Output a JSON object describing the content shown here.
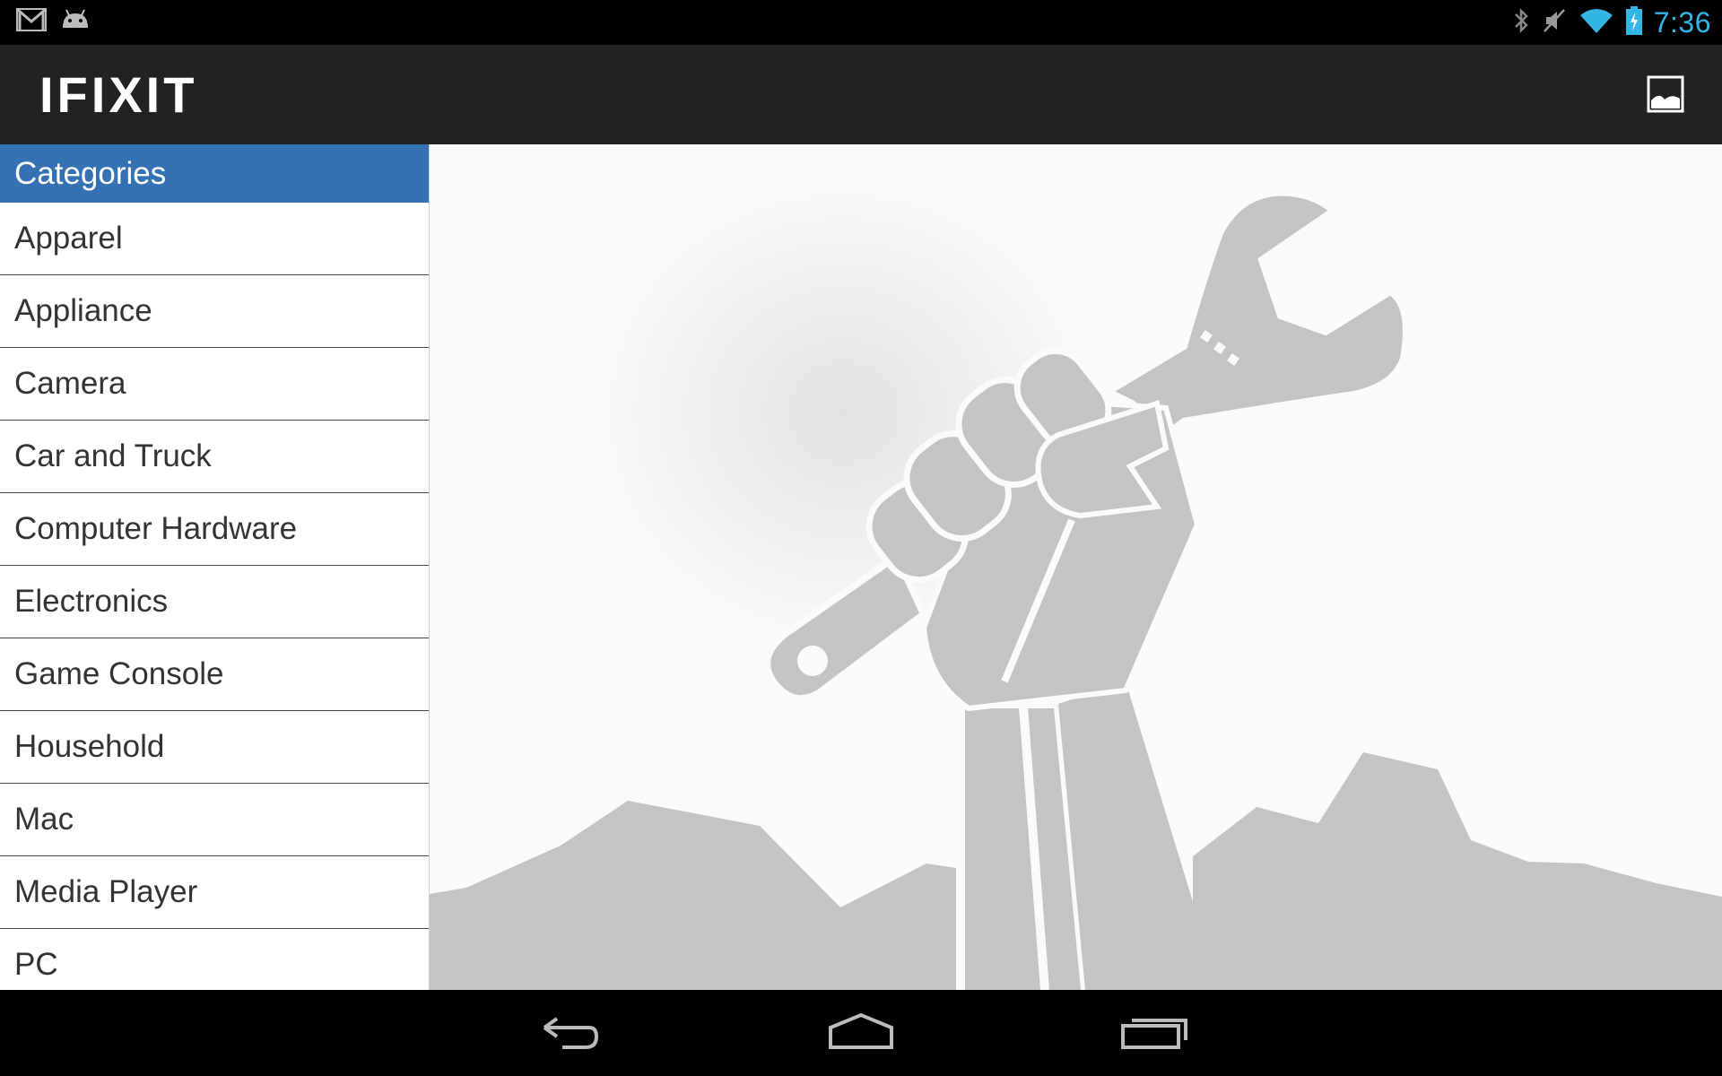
{
  "status_bar": {
    "time": "7:36",
    "left_icons": [
      "gmail-icon",
      "android-notification-icon"
    ],
    "right_icons": [
      "bluetooth-icon",
      "mute-icon",
      "wifi-icon",
      "battery-charging-icon"
    ]
  },
  "action_bar": {
    "logo": "IFIXIT",
    "gallery_icon": "gallery-icon"
  },
  "sidebar": {
    "header": "Categories",
    "items": [
      "Apparel",
      "Appliance",
      "Camera",
      "Car and Truck",
      "Computer Hardware",
      "Electronics",
      "Game Console",
      "Household",
      "Mac",
      "Media Player",
      "PC"
    ]
  },
  "main": {
    "illustration": "fist-holding-wrench-icon"
  },
  "nav_bar": {
    "buttons": [
      "back-icon",
      "home-icon",
      "recents-icon"
    ]
  },
  "colors": {
    "accent_blue": "#3472b3",
    "status_time": "#33b5e5",
    "action_bar_bg": "#222222",
    "illustration_gray": "#c4c4c4"
  }
}
